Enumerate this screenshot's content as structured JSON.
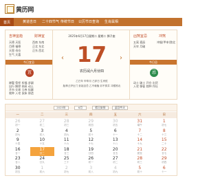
{
  "header": {
    "logo_text": "黄历网"
  },
  "nav": {
    "items": [
      "首页",
      "黄道吉日",
      "二十四节气",
      "传统节日",
      "公历节日查询",
      "生肖属相"
    ]
  },
  "panel": {
    "left_title_1": "吉神宜趋",
    "left_title_2": "财神宜",
    "left_words_1": [
      "天德",
      "天医",
      "月德",
      "福德",
      "天恩",
      "母仓",
      "生气",
      "天喜"
    ],
    "left_words_2": [
      "西南",
      "东南",
      "正北",
      "东北",
      "正东",
      "西北"
    ],
    "left_band": "今日宜忌",
    "left_circle": "宜",
    "left_small": [
      "嫁娶",
      "祭祀",
      "祈福",
      "求嗣",
      "出行",
      "解除",
      "纳采",
      "动土",
      "开市",
      "交易",
      "立券",
      "挂匾",
      "栽种",
      "入宅",
      "安床",
      "修造"
    ],
    "right_title_1": "凶煞宜忌",
    "right_title_2": "冲煞",
    "right_words_1": [
      "五离",
      "孤辰",
      "天牢",
      "月破"
    ],
    "right_words_2": [
      "冲猴(甲申)煞北"
    ],
    "right_band": "今日忌",
    "right_circle": "忌",
    "right_small": [
      "动土",
      "破土",
      "开仓",
      "出货",
      "入宅",
      "移徙",
      "栽种",
      "作灶"
    ]
  },
  "center": {
    "date_line": "2025年6月17日星期二 星期二 狮子座",
    "day": "17",
    "lunar": "农历闰六月廿四",
    "line_1": "乙巳年 甲申月 己卯日 生肖蛇",
    "line_2": "胎神占炉灶门 彭祖百忌 乙不栽植 卯不穿井 冲猴煞北"
  },
  "calendar": {
    "toolbar": {
      "year": "2025年",
      "month": "6月",
      "holiday": "假日安排",
      "today": "返回今天"
    },
    "week_days": [
      "一",
      "二",
      "三",
      "四",
      "五",
      "六",
      "日"
    ],
    "cells": [
      {
        "d": "26",
        "l": "初一"
      },
      {
        "d": "27",
        "l": "初二"
      },
      {
        "d": "28",
        "l": "初三"
      },
      {
        "d": "29",
        "l": "初四"
      },
      {
        "d": "30",
        "l": "初五"
      },
      {
        "d": "31",
        "l": "端午"
      },
      {
        "d": "1",
        "l": "初七"
      },
      {
        "d": "2",
        "l": "初七"
      },
      {
        "d": "3",
        "l": "初八"
      },
      {
        "d": "4",
        "l": "初九"
      },
      {
        "d": "5",
        "l": "初十"
      },
      {
        "d": "6",
        "l": "十一"
      },
      {
        "d": "7",
        "l": "十二"
      },
      {
        "d": "8",
        "l": "十三"
      },
      {
        "d": "9",
        "l": "十四"
      },
      {
        "d": "10",
        "l": "十五"
      },
      {
        "d": "11",
        "l": "十六"
      },
      {
        "d": "12",
        "l": "十七"
      },
      {
        "d": "13",
        "l": "十八"
      },
      {
        "d": "14",
        "l": "十九"
      },
      {
        "d": "15",
        "l": "二十"
      },
      {
        "d": "16",
        "l": "廿一"
      },
      {
        "d": "17",
        "l": "廿二"
      },
      {
        "d": "18",
        "l": "廿三"
      },
      {
        "d": "19",
        "l": "廿四"
      },
      {
        "d": "20",
        "l": "廿五"
      },
      {
        "d": "21",
        "l": "夏至"
      },
      {
        "d": "22",
        "l": "廿七"
      },
      {
        "d": "23",
        "l": "廿八"
      },
      {
        "d": "24",
        "l": "廿九"
      },
      {
        "d": "25",
        "l": "三十"
      },
      {
        "d": "26",
        "l": "初一"
      },
      {
        "d": "27",
        "l": "初二"
      },
      {
        "d": "28",
        "l": "初三"
      },
      {
        "d": "29",
        "l": "初四"
      },
      {
        "d": "30",
        "l": "初五"
      },
      {
        "d": "1",
        "l": "初六"
      },
      {
        "d": "2",
        "l": "初七"
      },
      {
        "d": "3",
        "l": "初八"
      },
      {
        "d": "4",
        "l": "初九"
      },
      {
        "d": "5",
        "l": "初十"
      },
      {
        "d": "6",
        "l": "十一"
      }
    ]
  }
}
